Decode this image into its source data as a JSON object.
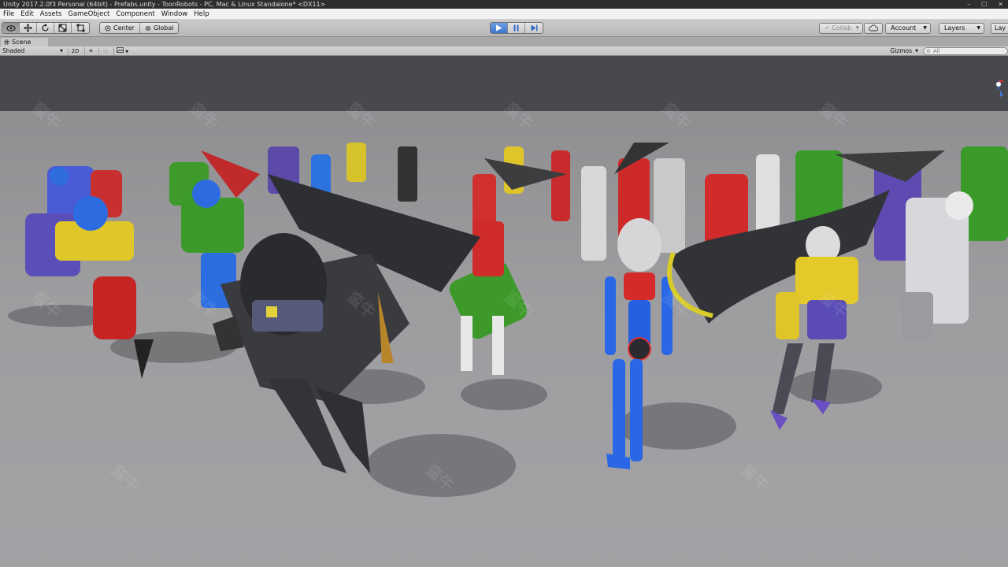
{
  "window": {
    "title": "Unity 2017.2.0f3 Personal (64bit) - Prefabs.unity - ToonRobots - PC, Mac & Linux Standalone* <DX11>",
    "controls": [
      "–",
      "☐",
      "✕"
    ]
  },
  "menu": [
    "File",
    "Edit",
    "Assets",
    "GameObject",
    "Component",
    "Window",
    "Help"
  ],
  "toolbar": {
    "pivot_label": "Center",
    "space_label": "Global",
    "collab_label": "Collab",
    "account_label": "Account",
    "layers_label": "Layers",
    "layout_label": "Lay"
  },
  "scene": {
    "tab_label": "Scene",
    "shading_mode": "Shaded",
    "mode_2d": "2D",
    "gizmos_label": "Gizmos",
    "search_placeholder": "All"
  },
  "watermark_text": "蛮牛"
}
